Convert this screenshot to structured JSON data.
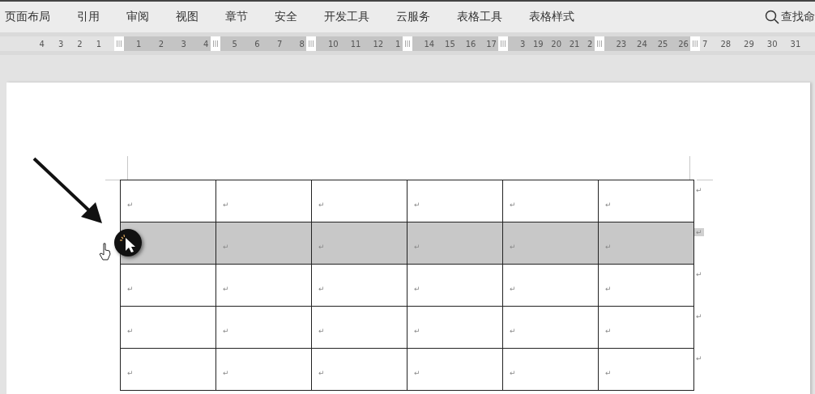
{
  "menu": {
    "tabs": [
      {
        "label": "页面布局",
        "selected": false
      },
      {
        "label": "引用",
        "selected": false
      },
      {
        "label": "审阅",
        "selected": false
      },
      {
        "label": "视图",
        "selected": false
      },
      {
        "label": "章节",
        "selected": false
      },
      {
        "label": "安全",
        "selected": false
      },
      {
        "label": "开发工具",
        "selected": false
      },
      {
        "label": "云服务",
        "selected": false
      },
      {
        "label": "表格工具",
        "selected": false
      },
      {
        "label": "表格样式",
        "selected": false
      }
    ],
    "search": {
      "label": "查找命"
    }
  },
  "ruler": {
    "segments": [
      {
        "kind": "margin-left",
        "labels": [
          "4",
          "3",
          "2",
          "1"
        ]
      },
      {
        "kind": "column",
        "labels": [
          "1",
          "2",
          "3",
          "4"
        ]
      },
      {
        "kind": "column",
        "labels": [
          "5",
          "6",
          "7",
          "8"
        ]
      },
      {
        "kind": "column",
        "labels": [
          "10",
          "11",
          "12",
          "1"
        ]
      },
      {
        "kind": "column",
        "labels": [
          "14",
          "15",
          "16",
          "17"
        ]
      },
      {
        "kind": "column",
        "labels": [
          "3",
          "19",
          "20",
          "21",
          "2"
        ]
      },
      {
        "kind": "column",
        "labels": [
          "23",
          "24",
          "25",
          "26"
        ]
      },
      {
        "kind": "margin-right",
        "labels": [
          "7",
          "28",
          "29",
          "30",
          "31"
        ]
      }
    ]
  },
  "table": {
    "rows": [
      {
        "selected": false,
        "cells": [
          "↵",
          "↵",
          "↵",
          "↵",
          "↵",
          "↵"
        ],
        "end_mark": "↵"
      },
      {
        "selected": true,
        "cells": [
          null,
          "↵",
          "↵",
          "↵",
          "↵",
          "↵"
        ],
        "end_mark": "↵"
      },
      {
        "selected": false,
        "cells": [
          "↵",
          "↵",
          "↵",
          "↵",
          "↵",
          "↵"
        ],
        "end_mark": "↵"
      },
      {
        "selected": false,
        "cells": [
          "↵",
          "↵",
          "↵",
          "↵",
          "↵",
          "↵"
        ],
        "end_mark": "↵"
      },
      {
        "selected": false,
        "cells": [
          "↵",
          "↵",
          "↵",
          "↵",
          "↵",
          "↵"
        ],
        "end_mark": "↵"
      }
    ]
  }
}
